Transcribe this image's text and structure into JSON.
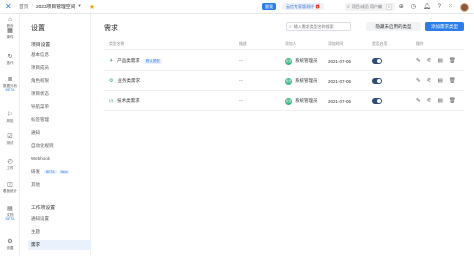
{
  "topbar": {
    "breadcrumbs": [
      "首页",
      "2023项目管理空间"
    ],
    "status_pill": "跟我",
    "enterprise_badge": "云信专家版测评 🎁",
    "search_placeholder": "项目/成员 用户编",
    "search_shortcut": "K"
  },
  "rail": {
    "items": [
      {
        "label": "首页",
        "icon": "home-icon"
      },
      {
        "label": "事件",
        "icon": "calendar-icon"
      },
      {
        "label": "迭代",
        "icon": "chart-icon"
      },
      {
        "label": "数据分析",
        "icon": "database-icon",
        "beta": "BETA"
      },
      {
        "label": "风险",
        "icon": "alert-icon"
      },
      {
        "label": "测试",
        "icon": "test-icon"
      },
      {
        "label": "工时",
        "icon": "clock-icon"
      },
      {
        "label": "看板统计",
        "icon": "board-icon"
      },
      {
        "label": "文档",
        "icon": "doc-icon",
        "beta": "BETA"
      },
      {
        "label": "设置",
        "icon": "gear-icon"
      }
    ]
  },
  "settings": {
    "title": "设置",
    "group1": "项目设置",
    "items1": [
      "基本信息",
      "项目成员",
      "角色权限",
      "项目状态",
      "导航菜单",
      "标签管理",
      "通知",
      "自动化规则",
      "Webhook",
      "研发",
      "其他"
    ],
    "yanfa_beta": "BETA",
    "yanfa_new": "New",
    "group2": "工作项设置",
    "items2": [
      "通知设置",
      "主题",
      "需求"
    ],
    "active_index": 2
  },
  "main": {
    "title": "需求",
    "search_placeholder": "输入需求类型名称搜索",
    "hide_button": "隐藏未启用的类型",
    "add_button": "添加需求类型",
    "columns": [
      "类型名称",
      "描述",
      "添加人",
      "添加时间",
      "是否启用",
      "操作"
    ],
    "rows": [
      {
        "icon": "✈",
        "icon_color": "#3aa57a",
        "name": "产品类需求",
        "default_tag": "默认类型",
        "desc": "--",
        "creator": "系统管理员",
        "avatar": "管理",
        "date": "2021-07-06",
        "enabled": true
      },
      {
        "icon": "⚙",
        "icon_color": "#3aa57a",
        "name": "业务类需求",
        "default_tag": "",
        "desc": "--",
        "creator": "系统管理员",
        "avatar": "管理",
        "date": "2021-07-06",
        "enabled": true
      },
      {
        "icon": "⟨/⟩",
        "icon_color": "#3aa57a",
        "name": "技术类需求",
        "default_tag": "",
        "desc": "--",
        "creator": "系统管理员",
        "avatar": "管理",
        "date": "2021-07-06",
        "enabled": true
      }
    ]
  },
  "colors": {
    "accent": "#2b7de9",
    "toggle_on": "#2b4a7a",
    "type_icon": "#3aa57a"
  }
}
